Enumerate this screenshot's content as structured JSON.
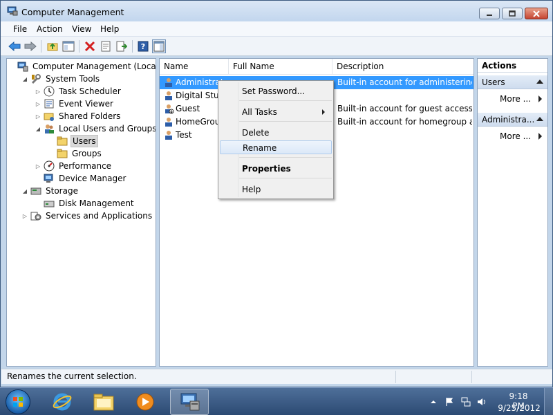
{
  "window": {
    "title": "Computer Management"
  },
  "menu": [
    "File",
    "Action",
    "View",
    "Help"
  ],
  "tree": [
    {
      "label": "Computer Management (Local)",
      "icon": "computer-management-icon",
      "indent": 0,
      "arrow": ""
    },
    {
      "label": "System Tools",
      "icon": "system-tools-icon",
      "indent": 1,
      "arrow": "expanded"
    },
    {
      "label": "Task Scheduler",
      "icon": "task-scheduler-icon",
      "indent": 2,
      "arrow": "collapsed"
    },
    {
      "label": "Event Viewer",
      "icon": "event-viewer-icon",
      "indent": 2,
      "arrow": "collapsed"
    },
    {
      "label": "Shared Folders",
      "icon": "shared-folders-icon",
      "indent": 2,
      "arrow": "collapsed"
    },
    {
      "label": "Local Users and Groups",
      "icon": "local-users-icon",
      "indent": 2,
      "arrow": "expanded"
    },
    {
      "label": "Users",
      "icon": "folder-icon",
      "indent": 3,
      "arrow": "",
      "selected": true
    },
    {
      "label": "Groups",
      "icon": "folder-icon",
      "indent": 3,
      "arrow": ""
    },
    {
      "label": "Performance",
      "icon": "performance-icon",
      "indent": 2,
      "arrow": "collapsed"
    },
    {
      "label": "Device Manager",
      "icon": "device-manager-icon",
      "indent": 2,
      "arrow": ""
    },
    {
      "label": "Storage",
      "icon": "storage-icon",
      "indent": 1,
      "arrow": "expanded"
    },
    {
      "label": "Disk Management",
      "icon": "disk-management-icon",
      "indent": 2,
      "arrow": ""
    },
    {
      "label": "Services and Applications",
      "icon": "services-icon",
      "indent": 1,
      "arrow": "collapsed"
    }
  ],
  "list": {
    "columns": [
      "Name",
      "Full Name",
      "Description"
    ],
    "rows": [
      {
        "name": "Administrator",
        "full_name": "",
        "description": "Built-in account for administering...",
        "selected": true
      },
      {
        "name": "Digital Stuff",
        "full_name": "",
        "description": ""
      },
      {
        "name": "Guest",
        "full_name": "",
        "description": "Built-in account for guest access t..."
      },
      {
        "name": "HomeGroupUser$",
        "full_name": "",
        "description": "Built-in account for homegroup a..."
      },
      {
        "name": "Test",
        "full_name": "",
        "description": ""
      }
    ]
  },
  "context_menu": {
    "set_password": "Set Password...",
    "all_tasks": "All Tasks",
    "delete": "Delete",
    "rename": "Rename",
    "properties": "Properties",
    "help": "Help"
  },
  "actions": {
    "title": "Actions",
    "group1": "Users",
    "more1": "More ...",
    "group2": "Administra...",
    "more2": "More ..."
  },
  "status": {
    "text": "Renames the current selection."
  },
  "clock": {
    "time": "9:18 PM",
    "date": "9/25/2012"
  },
  "colors": {
    "selection": "#3399ff",
    "accent": "#6b93c4"
  }
}
